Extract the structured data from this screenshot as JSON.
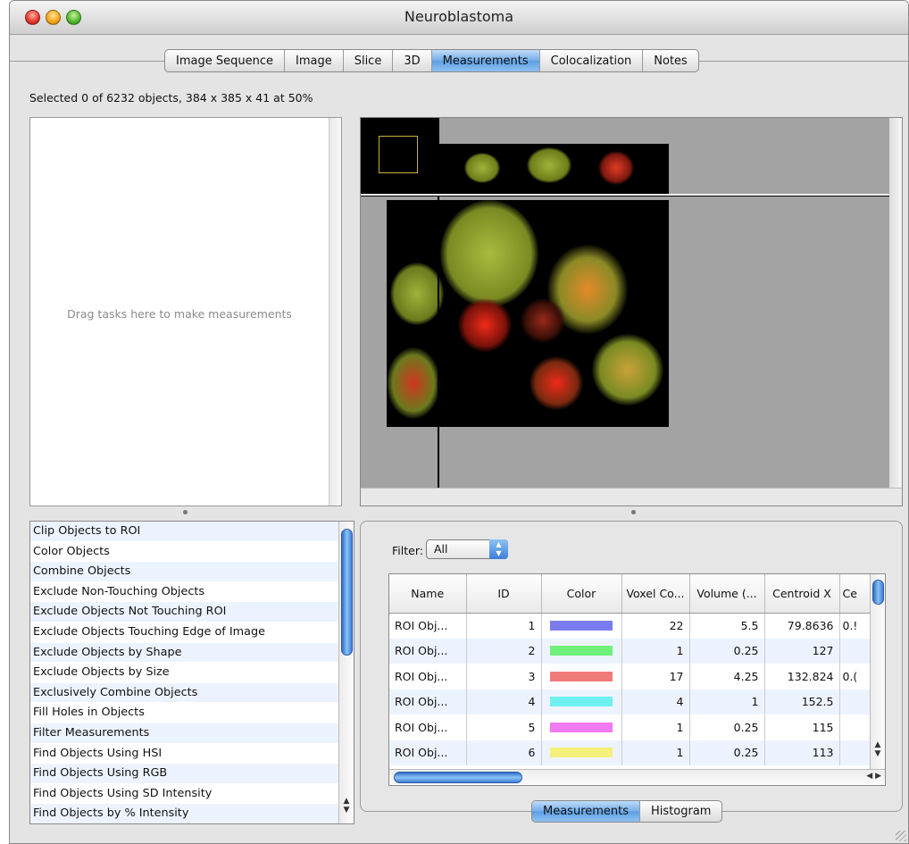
{
  "window": {
    "title": "Neuroblastoma"
  },
  "tabs": [
    {
      "label": "Image Sequence"
    },
    {
      "label": "Image"
    },
    {
      "label": "Slice"
    },
    {
      "label": "3D"
    },
    {
      "label": "Measurements",
      "active": true
    },
    {
      "label": "Colocalization"
    },
    {
      "label": "Notes"
    }
  ],
  "status_text": "Selected 0 of 6232 objects, 384 x 385 x 41 at 50%",
  "dropzone": {
    "hint": "Drag tasks here to make measurements"
  },
  "tasks": [
    "Clip Objects to ROI",
    "Color Objects",
    "Combine Objects",
    "Exclude Non-Touching Objects",
    "Exclude Objects Not Touching ROI",
    "Exclude Objects Touching Edge of Image",
    "Exclude Objects by Shape",
    "Exclude Objects by Size",
    "Exclusively Combine Objects",
    "Fill Holes in Objects",
    "Filter Measurements",
    "Find Objects Using HSI",
    "Find Objects Using RGB",
    "Find Objects Using SD Intensity",
    "Find Objects by % Intensity"
  ],
  "filter": {
    "label": "Filter:",
    "value": "All"
  },
  "table": {
    "columns": [
      "Name",
      "ID",
      "Color",
      "Voxel Co...",
      "Volume (...",
      "Centroid X",
      "Ce"
    ],
    "rows": [
      {
        "name": "ROI Obj...",
        "id": "1",
        "color": "#7b7bf0",
        "voxel": "22",
        "volume": "5.5",
        "cx": "79.8636",
        "cy": "0.!"
      },
      {
        "name": "ROI Obj...",
        "id": "2",
        "color": "#6ef07a",
        "voxel": "1",
        "volume": "0.25",
        "cx": "127",
        "cy": ""
      },
      {
        "name": "ROI Obj...",
        "id": "3",
        "color": "#f07a7a",
        "voxel": "17",
        "volume": "4.25",
        "cx": "132.824",
        "cy": "0.("
      },
      {
        "name": "ROI Obj...",
        "id": "4",
        "color": "#6ef0f0",
        "voxel": "4",
        "volume": "1",
        "cx": "152.5",
        "cy": ""
      },
      {
        "name": "ROI Obj...",
        "id": "5",
        "color": "#f07af0",
        "voxel": "1",
        "volume": "0.25",
        "cx": "115",
        "cy": ""
      },
      {
        "name": "ROI Obj...",
        "id": "6",
        "color": "#f5f07a",
        "voxel": "1",
        "volume": "0.25",
        "cx": "113",
        "cy": ""
      }
    ]
  },
  "bottom_tabs": [
    {
      "label": "Measurements",
      "active": true
    },
    {
      "label": "Histogram"
    }
  ]
}
